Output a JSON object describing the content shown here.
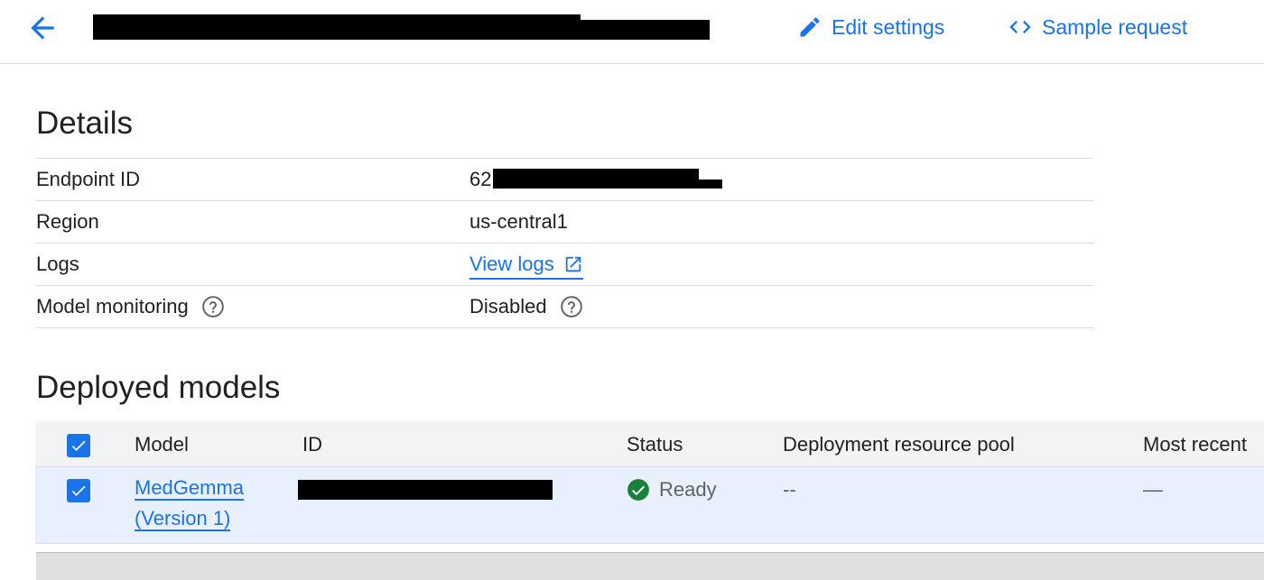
{
  "header": {
    "edit_label": "Edit settings",
    "sample_label": "Sample request"
  },
  "details": {
    "title": "Details",
    "rows": [
      {
        "label": "Endpoint ID",
        "value": "62"
      },
      {
        "label": "Region",
        "value": "us-central1"
      },
      {
        "label": "Logs",
        "value": "View logs"
      },
      {
        "label": "Model monitoring",
        "value": "Disabled"
      }
    ]
  },
  "deployed_models": {
    "title": "Deployed models",
    "columns": [
      "Model",
      "ID",
      "Status",
      "Deployment resource pool",
      "Most recent"
    ],
    "rows": [
      {
        "model_line1": "MedGemma",
        "model_line2": "(Version 1)",
        "status": "Ready",
        "pool": "--",
        "recent": "—"
      }
    ]
  },
  "colors": {
    "accent": "#1a73e8",
    "ready": "#188038",
    "selected_row": "#e8f0fe",
    "header_row": "#f1f3f4"
  }
}
